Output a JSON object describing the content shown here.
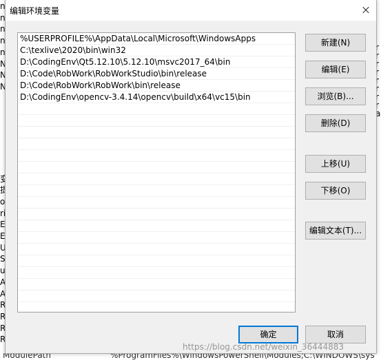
{
  "background": {
    "left_fragments": [
      "n",
      "n",
      "n",
      "n",
      "n",
      "N",
      "N",
      "N",
      "",
      "",
      "",
      "",
      "",
      "",
      "",
      "变",
      "提",
      "or",
      "ri",
      "El",
      "El",
      "U",
      "S",
      "ut",
      "A",
      "A",
      "R",
      "R",
      "R",
      "R"
    ],
    "right_fragments": [
      "r",
      "r",
      "r",
      "r",
      "r",
      "r",
      "r",
      "r",
      "a"
    ],
    "bottom_left": "ModulePath",
    "bottom_right": "%ProgramFiles%\\WindowsPowerShell\\Modules;C:\\WINDOWS\\sys"
  },
  "dialog": {
    "title": "编辑环境变量",
    "close_icon": "close-icon",
    "paths": [
      "%USERPROFILE%\\AppData\\Local\\Microsoft\\WindowsApps",
      "C:\\texlive\\2020\\bin\\win32",
      "D:\\CodingEnv\\Qt5.12.10\\5.12.10\\msvc2017_64\\bin",
      "D:\\Code\\RobWork\\RobWorkStudio\\bin\\release",
      "D:\\Code\\RobWork\\RobWork\\bin\\release",
      "D:\\CodingEnv\\opencv-3.4.14\\opencv\\build\\x64\\vc15\\bin"
    ],
    "buttons": {
      "new": "新建(N)",
      "edit": "编辑(E)",
      "browse": "浏览(B)...",
      "delete": "删除(D)",
      "move_up": "上移(U)",
      "move_down": "下移(O)",
      "edit_text": "编辑文本(T)...",
      "ok": "确定",
      "cancel": "取消"
    }
  },
  "watermark": "https://blog.csdn.net/weixin_36444883"
}
